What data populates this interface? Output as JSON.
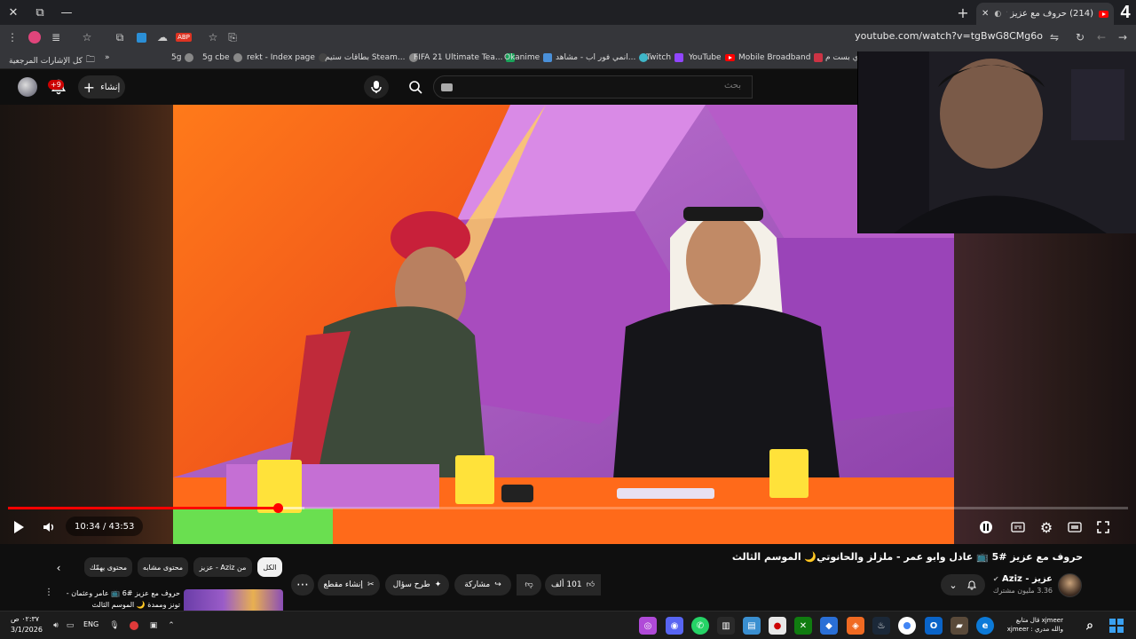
{
  "browser": {
    "tab_count_label": "4",
    "active_tab_title": "(214) حروف مع عزيز #5",
    "url": "youtube.com/watch?v=tgBwG8CMg6o",
    "bookmarks": [
      {
        "label": "YouTube",
        "color": "#ff0000"
      },
      {
        "label": "Twitch",
        "color": "#9146ff"
      },
      {
        "label": "انمي فور اب - مشاهد...",
        "color": "#3fb6c8"
      },
      {
        "label": "Okanime",
        "color": "#4a90d9"
      },
      {
        "label": "FIFA 21 Ultimate Tea...",
        "color": "#1aa35a"
      },
      {
        "label": "بطاقات ستيم Steam...",
        "color": "#888888"
      },
      {
        "label": "rekt - Index page",
        "color": "#444444"
      },
      {
        "label": "5g cbe",
        "color": "#888888"
      },
      {
        "label": "5g",
        "color": "#888888"
      },
      {
        "label": "Mobile Broadband",
        "color": "#cc3344"
      },
      {
        "label": "كل الإشارات المرجعية",
        "color": "#dddddd"
      }
    ],
    "bookmark_tail": "ي بست م..."
  },
  "youtube": {
    "notification_badge": "+9",
    "create_label": "إنشاء",
    "search_placeholder": "بحث",
    "player": {
      "time_display": "10:34 / 43:53",
      "played_fraction": 0.241,
      "buffered_fraction": 0.265
    },
    "video_title": "حروف مع عزيز #5 📺 عادل وابو عمر - ملزلز والحانوتي🌙 الموسم الثالث",
    "channel": {
      "name": "عزيز - Aziz",
      "subscribers": "3.36 مليون مشترك"
    },
    "actions": {
      "likes": "101 ألف",
      "share": "مشاركة",
      "ask": "طرح سؤال",
      "clip": "إنشاء مقطع",
      "more": "⋯"
    },
    "chips": {
      "all": "الكل",
      "from_channel": "من Aziz - عزيز",
      "related": "محتوى مشابه",
      "interest": "محتوى يهمّك"
    },
    "recommended": {
      "title": "حروف مع عزيز #6 📺 عامر وعثمان - تونز وممدة 🌙 الموسم الثالث"
    }
  },
  "taskbar": {
    "time": "٠٢:٣٧ ص",
    "date": "3/1/2026",
    "language": "ENG",
    "notification_line1": "xjmeer قال متابع",
    "notification_line2": "والله مدري : xjmeer"
  },
  "colors": {
    "accent": "#ff0000",
    "background": "#0f0f0f",
    "chip_bg": "#272727"
  }
}
